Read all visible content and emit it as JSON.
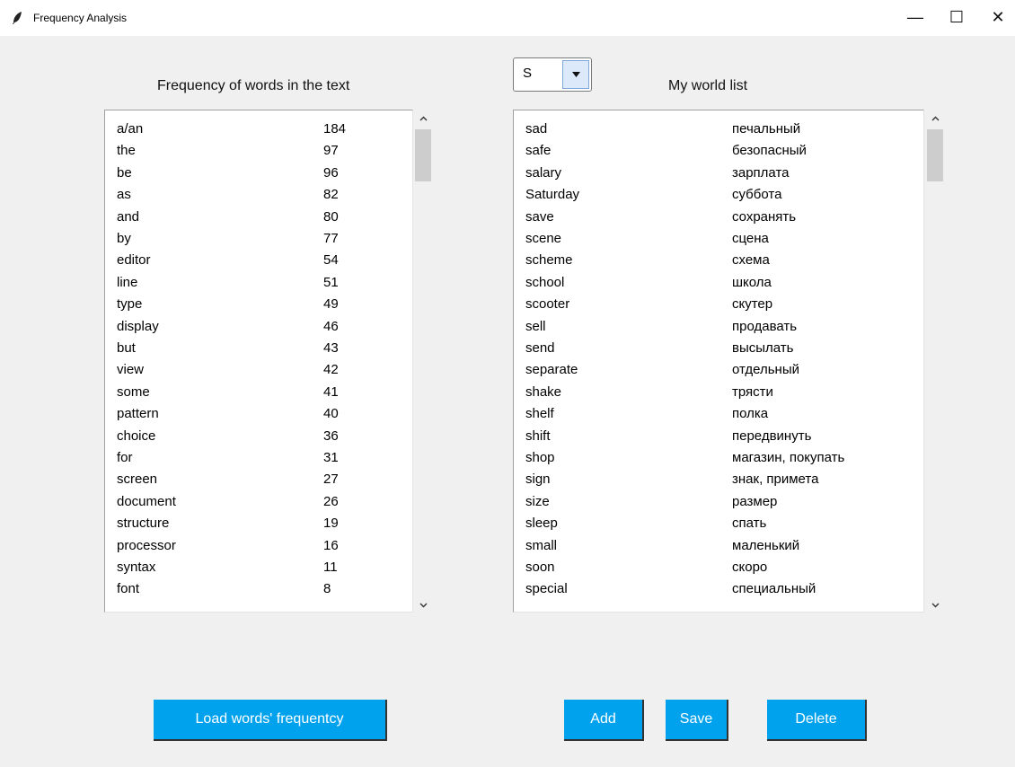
{
  "window": {
    "title": "Frequency Analysis",
    "minimize_glyph": "—",
    "maximize_glyph": "☐",
    "close_glyph": "✕"
  },
  "left_panel": {
    "heading": "Frequency of words in the text",
    "rows": [
      {
        "word": "a/an",
        "count": "184"
      },
      {
        "word": "the",
        "count": "97"
      },
      {
        "word": "be",
        "count": "96"
      },
      {
        "word": "as",
        "count": "82"
      },
      {
        "word": "and",
        "count": "80"
      },
      {
        "word": "by",
        "count": "77"
      },
      {
        "word": "editor",
        "count": "54"
      },
      {
        "word": "line",
        "count": "51"
      },
      {
        "word": "type",
        "count": "49"
      },
      {
        "word": "display",
        "count": "46"
      },
      {
        "word": "but",
        "count": "43"
      },
      {
        "word": "view",
        "count": "42"
      },
      {
        "word": "some",
        "count": "41"
      },
      {
        "word": "pattern",
        "count": "40"
      },
      {
        "word": "choice",
        "count": "36"
      },
      {
        "word": "for",
        "count": "31"
      },
      {
        "word": "screen",
        "count": "27"
      },
      {
        "word": "document",
        "count": "26"
      },
      {
        "word": "structure",
        "count": "19"
      },
      {
        "word": "processor",
        "count": "16"
      },
      {
        "word": "syntax",
        "count": "11"
      },
      {
        "word": "font",
        "count": "8"
      }
    ]
  },
  "letter_select": {
    "value": "S"
  },
  "right_panel": {
    "heading": "My world list",
    "rows": [
      {
        "word": "sad",
        "translation": "печальный"
      },
      {
        "word": "safe",
        "translation": "безопасный"
      },
      {
        "word": "salary",
        "translation": "зарплата"
      },
      {
        "word": "Saturday",
        "translation": "суббота"
      },
      {
        "word": "save",
        "translation": "сохранять"
      },
      {
        "word": "scene",
        "translation": "сцена"
      },
      {
        "word": "scheme",
        "translation": "схема"
      },
      {
        "word": "school",
        "translation": "школа"
      },
      {
        "word": "scooter",
        "translation": "скутер"
      },
      {
        "word": "sell",
        "translation": "продавать"
      },
      {
        "word": "send",
        "translation": "высылать"
      },
      {
        "word": "separate",
        "translation": "отдельный"
      },
      {
        "word": "shake",
        "translation": "трясти"
      },
      {
        "word": "shelf",
        "translation": "полка"
      },
      {
        "word": "shift",
        "translation": "передвинуть"
      },
      {
        "word": "shop",
        "translation": "магазин, покупать"
      },
      {
        "word": "sign",
        "translation": "знак, примета"
      },
      {
        "word": "size",
        "translation": "размер"
      },
      {
        "word": "sleep",
        "translation": "спать"
      },
      {
        "word": "small",
        "translation": "маленький"
      },
      {
        "word": "soon",
        "translation": "скоро"
      },
      {
        "word": "special",
        "translation": "специальный"
      }
    ]
  },
  "buttons": {
    "load": "Load words' frequentcy",
    "add": "Add",
    "save": "Save",
    "delete": "Delete"
  },
  "colors": {
    "button_bg": "#00a2ed",
    "button_text": "#ffffff",
    "window_bg": "#f0f0f0"
  },
  "icons": {
    "app": "feather-icon",
    "scroll_up": "chevron-up-icon",
    "scroll_down": "chevron-down-icon",
    "dropdown": "triangle-down-icon"
  }
}
